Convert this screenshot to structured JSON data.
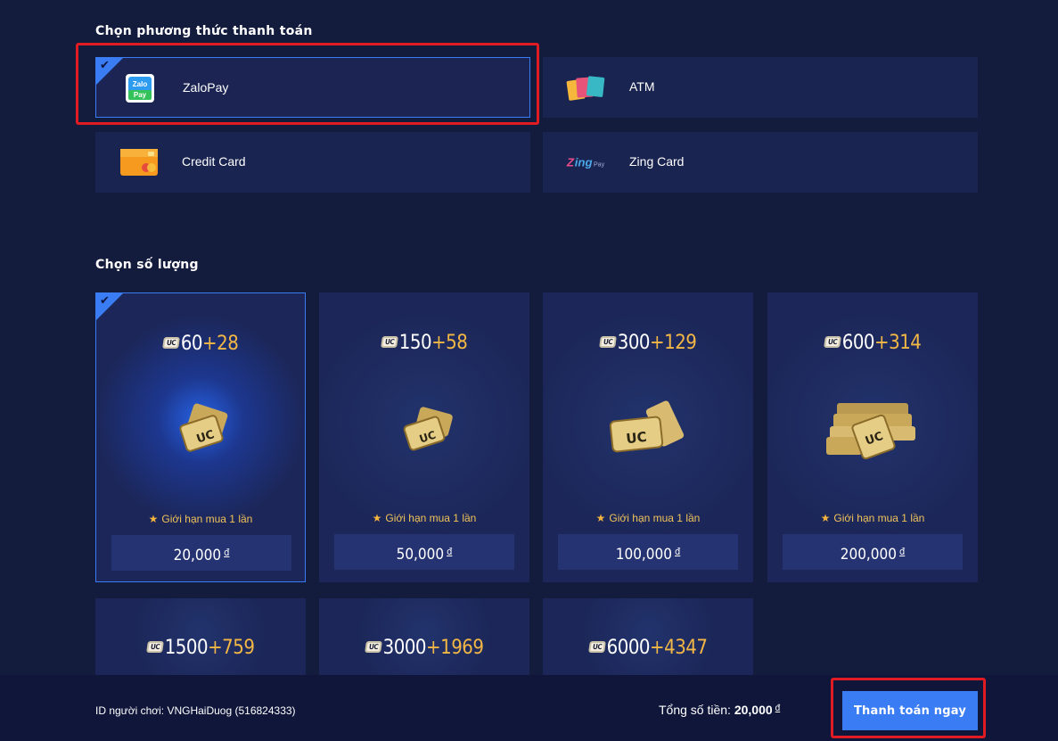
{
  "payment_section": {
    "title": "Chọn phương thức thanh toán",
    "methods": [
      {
        "label": "ZaloPay",
        "icon": "zalopay-icon",
        "selected": true
      },
      {
        "label": "ATM",
        "icon": "atm-cards-icon",
        "selected": false
      },
      {
        "label": "Credit Card",
        "icon": "credit-card-icon",
        "selected": false
      },
      {
        "label": "Zing Card",
        "icon": "zing-pay-icon",
        "selected": false
      }
    ]
  },
  "quantity_section": {
    "title": "Chọn số lượng",
    "currency_badge": "UC",
    "packages": [
      {
        "base": "60",
        "bonus": "+28",
        "limit": "Giới hạn mua 1 lần",
        "price": "20,000",
        "currency": "đ",
        "selected": true
      },
      {
        "base": "150",
        "bonus": "+58",
        "limit": "Giới hạn mua 1 lần",
        "price": "50,000",
        "currency": "đ",
        "selected": false
      },
      {
        "base": "300",
        "bonus": "+129",
        "limit": "Giới hạn mua 1 lần",
        "price": "100,000",
        "currency": "đ",
        "selected": false
      },
      {
        "base": "600",
        "bonus": "+314",
        "limit": "Giới hạn mua 1 lần",
        "price": "200,000",
        "currency": "đ",
        "selected": false
      },
      {
        "base": "1500",
        "bonus": "+759"
      },
      {
        "base": "3000",
        "bonus": "+1969"
      },
      {
        "base": "6000",
        "bonus": "+4347"
      }
    ]
  },
  "footer": {
    "player_id": "ID người chơi: VNGHaiDuog (516824333)",
    "total_label": "Tổng số tiền:",
    "total_value": "20,000",
    "total_currency": "đ",
    "pay_button": "Thanh toán ngay"
  },
  "colors": {
    "background": "#141c3e",
    "card": "#1a2450",
    "accent": "#3a7cf4",
    "bonus": "#f3b745",
    "highlight": "#e11b22"
  }
}
